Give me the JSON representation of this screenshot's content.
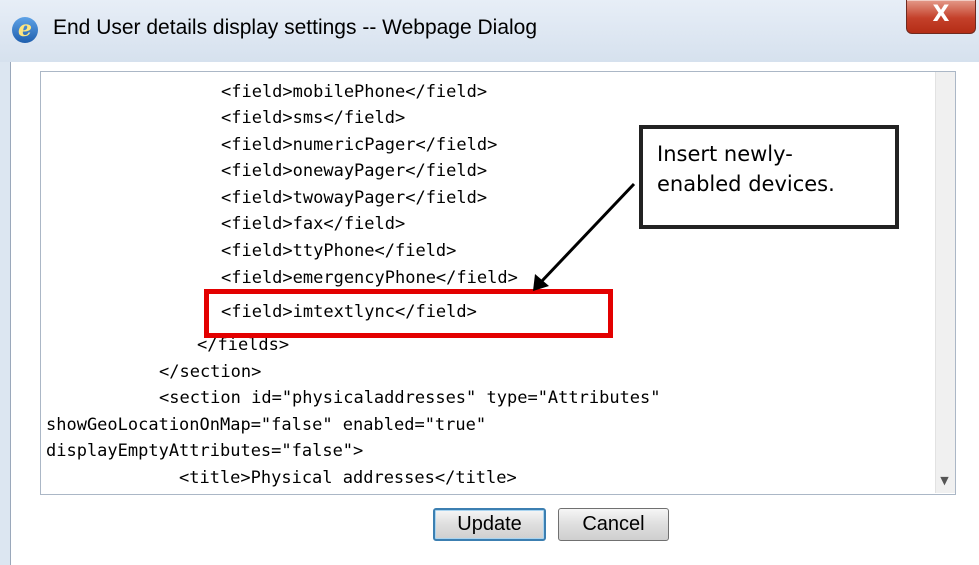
{
  "window": {
    "title": "End User details display settings -- Webpage Dialog",
    "close_label": "X"
  },
  "code_lines": [
    "<field>mobilePhone</field>",
    "<field>sms</field>",
    "<field>numericPager</field>",
    "<field>onewayPager</field>",
    "<field>twowayPager</field>",
    "<field>fax</field>",
    "<field>ttyPhone</field>",
    "<field>emergencyPhone</field>",
    "<field>imtextlync</field>",
    "</fields>",
    "</section>",
    "<section id=\"physicaladdresses\" type=\"Attributes\"",
    "showGeoLocationOnMap=\"false\" enabled=\"true\"",
    "displayEmptyAttributes=\"false\">",
    "<title>Physical addresses</title>"
  ],
  "callout": {
    "line1": "Insert newly-",
    "line2": "enabled devices."
  },
  "buttons": {
    "update": "Update",
    "cancel": "Cancel"
  },
  "colors": {
    "highlight": "#e30000",
    "primary_button_border": "#3c7fb1"
  }
}
